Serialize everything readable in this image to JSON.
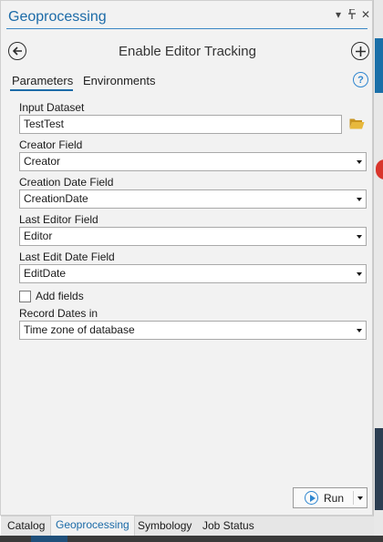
{
  "pane": {
    "title": "Geoprocessing",
    "titlebar_icons": {
      "menu": "▾",
      "pin": "📌",
      "close": "✕"
    }
  },
  "tool": {
    "title": "Enable Editor Tracking",
    "back_icon": "arrow-left-icon",
    "add_icon": "plus-circle-icon"
  },
  "tabs": {
    "parameters": "Parameters",
    "environments": "Environments",
    "help": "?"
  },
  "form": {
    "input_dataset": {
      "label": "Input Dataset",
      "value": "TestTest"
    },
    "creator_field": {
      "label": "Creator Field",
      "value": "Creator"
    },
    "creation_date_field": {
      "label": "Creation Date Field",
      "value": "CreationDate"
    },
    "last_editor_field": {
      "label": "Last Editor Field",
      "value": "Editor"
    },
    "last_edit_date_field": {
      "label": "Last Edit Date Field",
      "value": "EditDate"
    },
    "add_fields": {
      "label": "Add fields",
      "checked": false
    },
    "record_dates_in": {
      "label": "Record Dates in",
      "value": "Time zone of database"
    }
  },
  "run_button": {
    "label": "Run"
  },
  "bottom_tabs": [
    {
      "label": "Catalog",
      "active": false
    },
    {
      "label": "Geoprocessing",
      "active": true
    },
    {
      "label": "Symbology",
      "active": false
    },
    {
      "label": "Job Status",
      "active": false
    }
  ],
  "colors": {
    "accent": "#1c6ba8",
    "help_blue": "#2f86cf",
    "folder_yellow": "#d9a62e"
  }
}
